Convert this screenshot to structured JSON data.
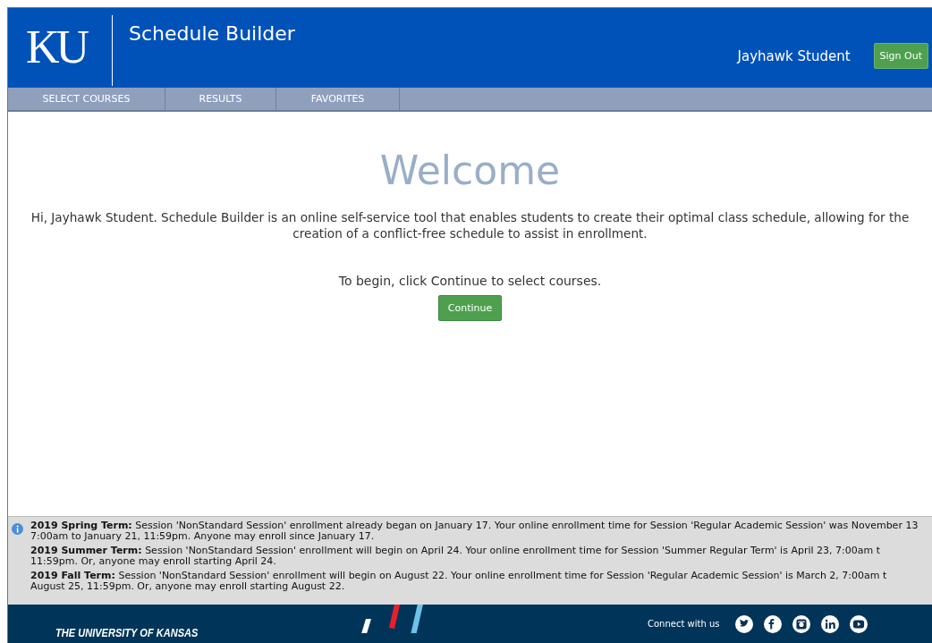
{
  "header": {
    "logo": "KU",
    "title": "Schedule Builder",
    "user": "Jayhawk Student",
    "sign_out": "Sign Out"
  },
  "nav": [
    {
      "label": "SELECT COURSES",
      "selected": false
    },
    {
      "label": "RESULTS",
      "selected": false
    },
    {
      "label": "FAVORITES",
      "selected": false
    }
  ],
  "main": {
    "heading": "Welcome",
    "intro": "Hi, Jayhawk Student. Schedule Builder is an online self-service tool that enables students to create their optimal class schedule, allowing for the creation of a conflict-free schedule to assist in enrollment.",
    "prompt": "To begin, click Continue to select courses.",
    "button": "Continue"
  },
  "notices": [
    {
      "lines": [
        "**2019 Spring Term:** Session 'NonStandard Session' enrollment already began on January 17. Your online enrollment time for Session 'Regular Academic Session' was November 13",
        "7:00am to January 21, 11:59pm. Anyone may enroll since January 17."
      ]
    },
    {
      "lines": [
        "**2019 Summer Term:** Session 'NonStandard Session' enrollment will begin on April 24. Your online enrollment time for Session 'Summer Regular Term' is April 23, 7:00am t",
        "11:59pm. Or, anyone may enroll starting April 24."
      ]
    },
    {
      "lines": [
        "**2019 Fall Term:** Session 'NonStandard Session' enrollment will begin on August 22. Your online enrollment time for Session 'Regular Academic Session' is March 2, 7:00am t",
        "August 25, 11:59pm. Or, anyone may enroll starting August 22."
      ]
    }
  ],
  "footer": {
    "university": "THE UNIVERSITY OF KANSAS",
    "connect": "Connect with us",
    "social": [
      {
        "kind": "twitter"
      },
      {
        "kind": "facebook"
      },
      {
        "kind": "instagram"
      },
      {
        "kind": "linkedin"
      },
      {
        "kind": "youtube"
      }
    ]
  }
}
